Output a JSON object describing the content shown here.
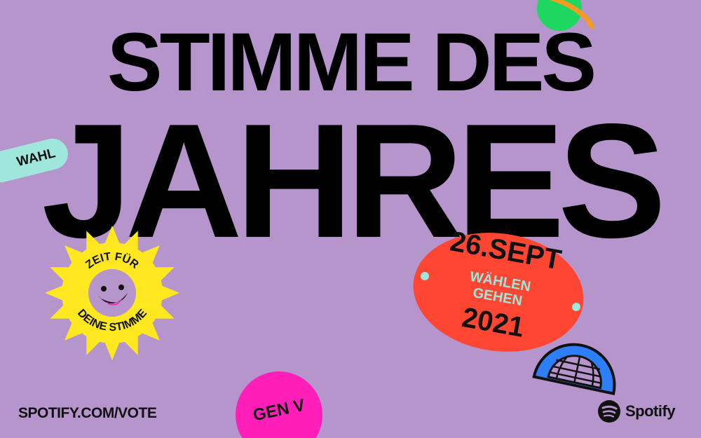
{
  "headline": {
    "line1": "STIMME DES",
    "line2": "JAHRES"
  },
  "stickers": {
    "wahl": "WAHL",
    "sun_top": "ZEIT FÜR",
    "sun_bottom": "DEINE STIMME",
    "date_top": "26.SEPT",
    "date_middle_1": "WÄHLEN",
    "date_middle_2": "GEHEN",
    "date_bottom": "2021",
    "gen_v": "GEN V"
  },
  "footer": {
    "url": "SPOTIFY.COM/VOTE",
    "brand": "Spotify"
  },
  "icons": [
    "planet-icon",
    "smiley-sun-icon",
    "globe-dome-icon",
    "spotify-logo-icon"
  ],
  "colors": {
    "background": "#b595cc",
    "headline": "#000000",
    "pill": "#9fe6dc",
    "sun": "#ffe81f",
    "badge": "#ff4632",
    "badge_text": "#9fe6dc",
    "dome": "#2d7ff9",
    "gen_v": "#ff1fb8",
    "planet": "#1ed760",
    "ring": "#f59b23"
  }
}
